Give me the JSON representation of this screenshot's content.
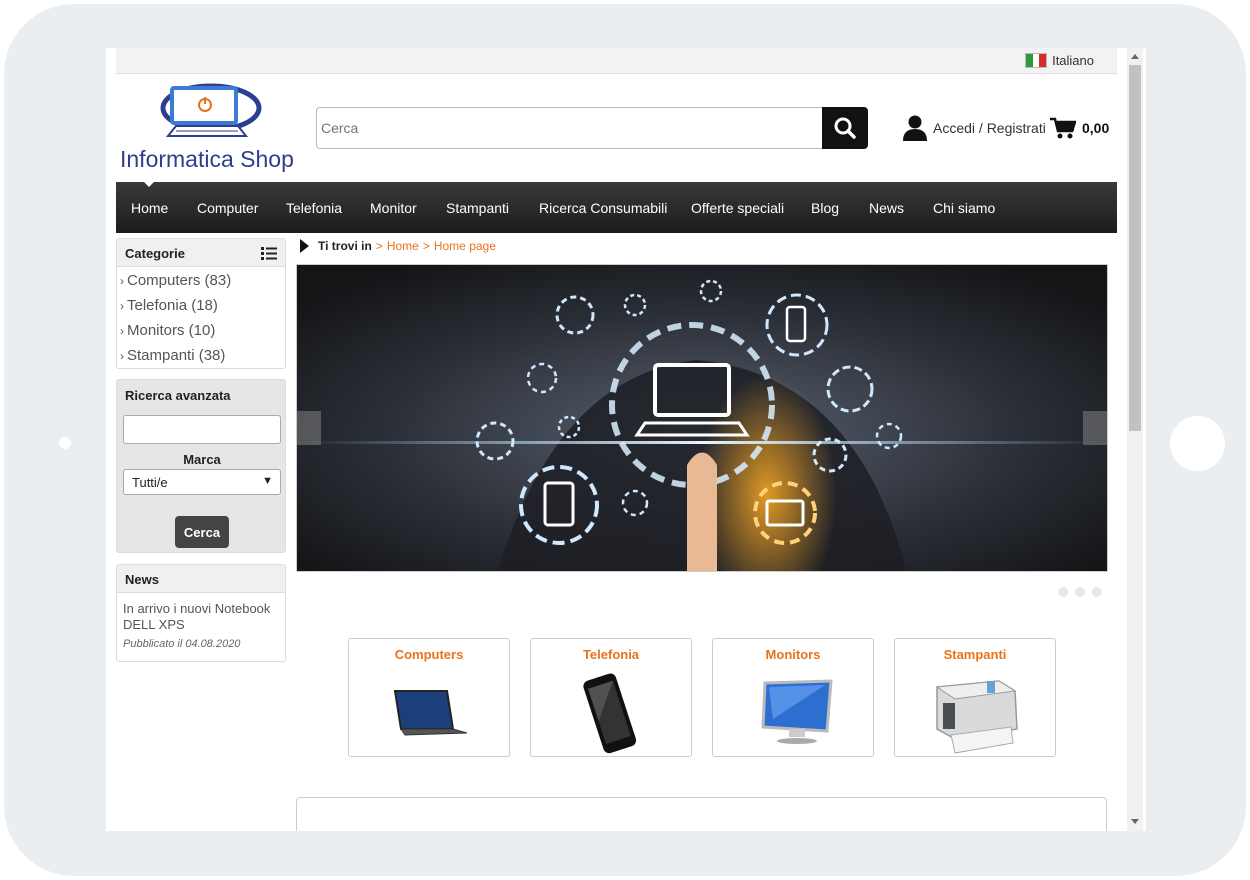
{
  "topbar": {
    "language": "Italiano"
  },
  "header": {
    "logo_text": "Informatica Shop",
    "search_placeholder": "Cerca",
    "account_label": "Accedi / Registrati",
    "cart_total": "0,00"
  },
  "nav": {
    "items": [
      {
        "label": "Home"
      },
      {
        "label": "Computer"
      },
      {
        "label": "Telefonia"
      },
      {
        "label": "Monitor"
      },
      {
        "label": "Stampanti"
      },
      {
        "label": "Ricerca Consumabili"
      },
      {
        "label": "Offerte speciali"
      },
      {
        "label": "Blog"
      },
      {
        "label": "News"
      },
      {
        "label": "Chi siamo"
      }
    ]
  },
  "sidebar": {
    "categories_title": "Categorie",
    "categories": [
      {
        "label": "Computers (83)"
      },
      {
        "label": "Telefonia (18)"
      },
      {
        "label": "Monitors (10)"
      },
      {
        "label": "Stampanti (38)"
      }
    ],
    "advanced_search": {
      "title": "Ricerca avanzata",
      "brand_label": "Marca",
      "brand_value": "Tutti/e",
      "button": "Cerca"
    },
    "news": {
      "title": "News",
      "headline": "In arrivo i nuovi Notebook DELL XPS",
      "date": "Pubblicato il 04.08.2020"
    }
  },
  "breadcrumb": {
    "prefix": "Ti trovi in",
    "sep": ">",
    "home": "Home",
    "current": "Home page"
  },
  "category_cards": [
    {
      "title": "Computers"
    },
    {
      "title": "Telefonia"
    },
    {
      "title": "Monitors"
    },
    {
      "title": "Stampanti"
    }
  ],
  "colors": {
    "accent": "#e8731c",
    "nav_bg": "#2a2a2a",
    "logo_blue": "#2d3e8f"
  }
}
